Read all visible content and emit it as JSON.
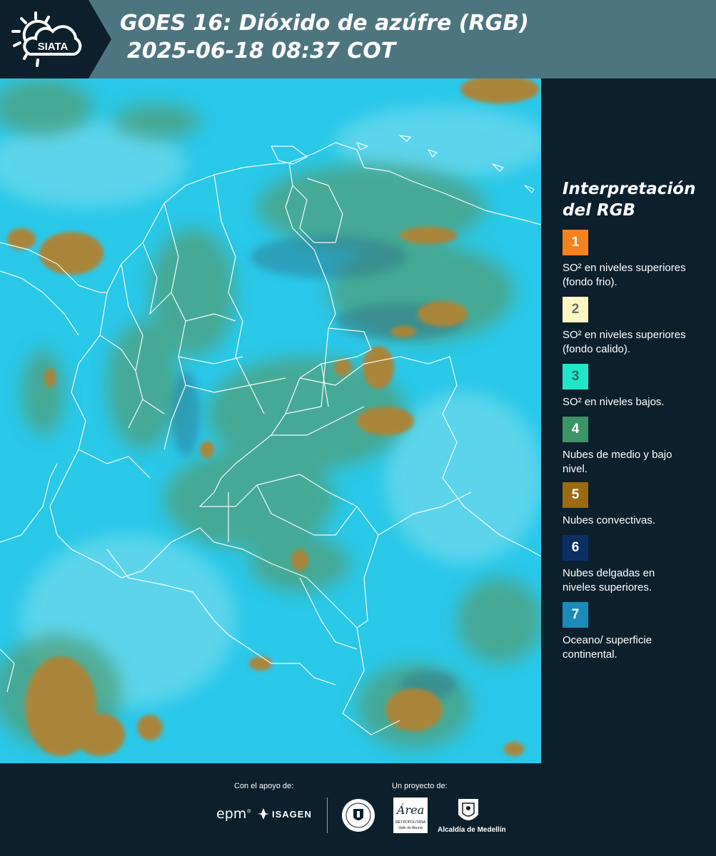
{
  "header": {
    "logo_text": "SIATA",
    "title_line1": "GOES 16: Dióxido de azúfre (RGB)",
    "title_line2": "2025-06-18 08:37 COT"
  },
  "legend": {
    "title_line1": "Interpretación",
    "title_line2": "del RGB",
    "items": [
      {
        "number": "1",
        "color": "#f5821f",
        "text_color": "#ffffff",
        "label": "SO² en niveles superiores (fondo frio)."
      },
      {
        "number": "2",
        "color": "#fff7c2",
        "text_color": "#6b6b6b",
        "label": "SO² en niveles superiores (fondo calido)."
      },
      {
        "number": "3",
        "color": "#1fe6c8",
        "text_color": "#2f6f6a",
        "label": "SO² en niveles bajos."
      },
      {
        "number": "4",
        "color": "#3c9566",
        "text_color": "#ffffff",
        "label": "Nubes de medio y bajo nivel."
      },
      {
        "number": "5",
        "color": "#9c6a12",
        "text_color": "#ffffff",
        "label": "Nubes convectivas."
      },
      {
        "number": "6",
        "color": "#0b2f63",
        "text_color": "#ffffff",
        "label": "Nubes delgadas en niveles superiores."
      },
      {
        "number": "7",
        "color": "#1a8ab8",
        "text_color": "#ffffff",
        "label": "Oceano/ superficie continental."
      }
    ]
  },
  "footer": {
    "support_label": "Con el apoyo de:",
    "project_label": "Un proyecto de:",
    "epm_text": "epm",
    "isagen_text": "ISAGEN",
    "area_text": "Área",
    "area_sub1": "METROPOLITANA",
    "area_sub2": "Valle de Aburrá",
    "alcaldia_text": "Alcaldía de Medellín"
  },
  "colors": {
    "background": "#0c1f2d",
    "header_band": "#4d7580",
    "ocean": "#29c7e8",
    "land_cloud": "#5fa873",
    "convective": "#a9853a"
  }
}
